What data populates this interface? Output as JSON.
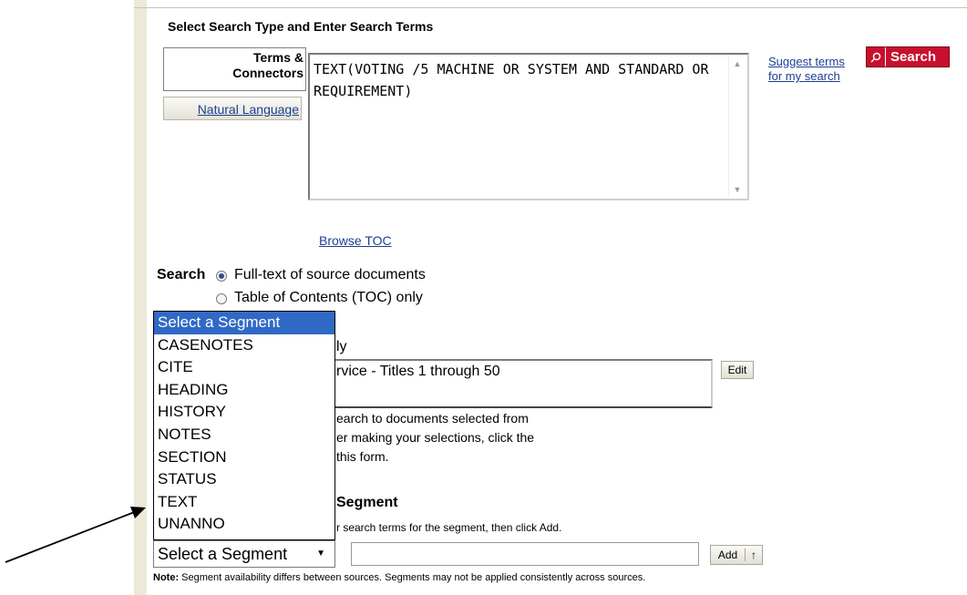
{
  "title": "Select Search Type and Enter Search Terms",
  "search_type": {
    "active": "Terms & Connectors",
    "active_line1": "Terms &",
    "active_line2": "Connectors",
    "inactive": "Natural Language"
  },
  "query": "TEXT(VOTING /5 MACHINE OR SYSTEM AND STANDARD OR REQUIREMENT)",
  "suggest": {
    "line1": "Suggest terms",
    "line2": "for my search"
  },
  "search_button": "Search",
  "browse_toc": "Browse TOC",
  "search_scope": {
    "label": "Search",
    "options": [
      {
        "label": "Full-text of source documents",
        "selected": true
      },
      {
        "label": "Table of Contents (TOC) only",
        "selected": false
      }
    ]
  },
  "segment_dropdown": {
    "options": [
      "Select a Segment",
      "CASENOTES",
      "CITE",
      "HEADING",
      "HISTORY",
      "NOTES",
      "SECTION",
      "STATUS",
      "TEXT",
      "UNANNO"
    ],
    "highlighted": 0,
    "value": "Select a Segment"
  },
  "obscured": {
    "line_ly": "ly",
    "source_text": "rvice - Titles 1 through 50",
    "help1": "earch to documents selected from",
    "help2": "er making your selections, click the",
    "help3": " this form.",
    "segment_heading": "Segment",
    "segment_help": "r search terms for the segment, then click Add."
  },
  "edit_button": "Edit",
  "add_button": "Add",
  "up_arrow": "↑",
  "note_label": "Note:",
  "note_text": " Segment availability differs between sources. Segments may not be applied consistently across sources."
}
